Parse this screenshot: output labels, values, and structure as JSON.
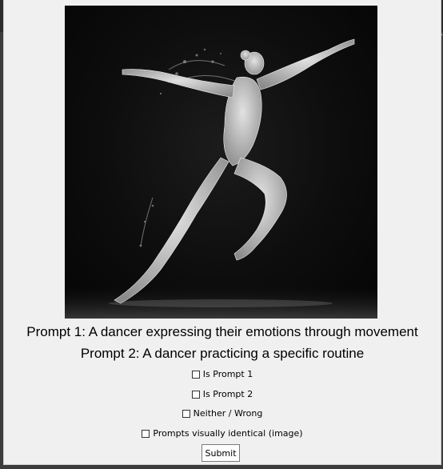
{
  "backdrop": {
    "edge_text": ":.."
  },
  "image": {
    "icon": "dancer-photo"
  },
  "prompts": {
    "prompt1": "Prompt 1: A dancer expressing their emotions through movement",
    "prompt2": "Prompt 2: A dancer practicing a specific routine"
  },
  "options": {
    "is_prompt_1": "Is Prompt 1",
    "is_prompt_2": "Is Prompt 2",
    "neither": "Neither / Wrong",
    "identical": "Prompts visually identical (image)"
  },
  "submit_label": "Submit"
}
